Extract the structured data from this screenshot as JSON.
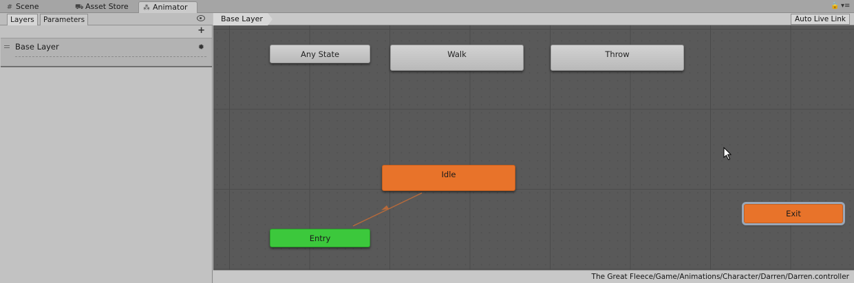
{
  "tabs": [
    {
      "label": "Scene",
      "icon": "grid-icon"
    },
    {
      "label": "Asset Store",
      "icon": "cart-icon"
    },
    {
      "label": "Animator",
      "icon": "animator-icon"
    }
  ],
  "left_panel": {
    "tabs": [
      "Layers",
      "Parameters"
    ],
    "add_label": "+",
    "layers": [
      {
        "name": "Base Layer"
      }
    ]
  },
  "graph_header": {
    "breadcrumb": "Base Layer",
    "auto_live_link": "Auto Live Link"
  },
  "states": {
    "any_state": "Any State",
    "walk": "Walk",
    "throw": "Throw",
    "idle": "Idle",
    "entry": "Entry",
    "exit": "Exit"
  },
  "colors": {
    "default_state": "#e8732a",
    "entry": "#3cc83c",
    "exit": "#e8732a",
    "state": "#c8c8c8"
  },
  "status": {
    "controller_path": "The Great Fleece/Game/Animations/Character/Darren/Darren.controller"
  }
}
